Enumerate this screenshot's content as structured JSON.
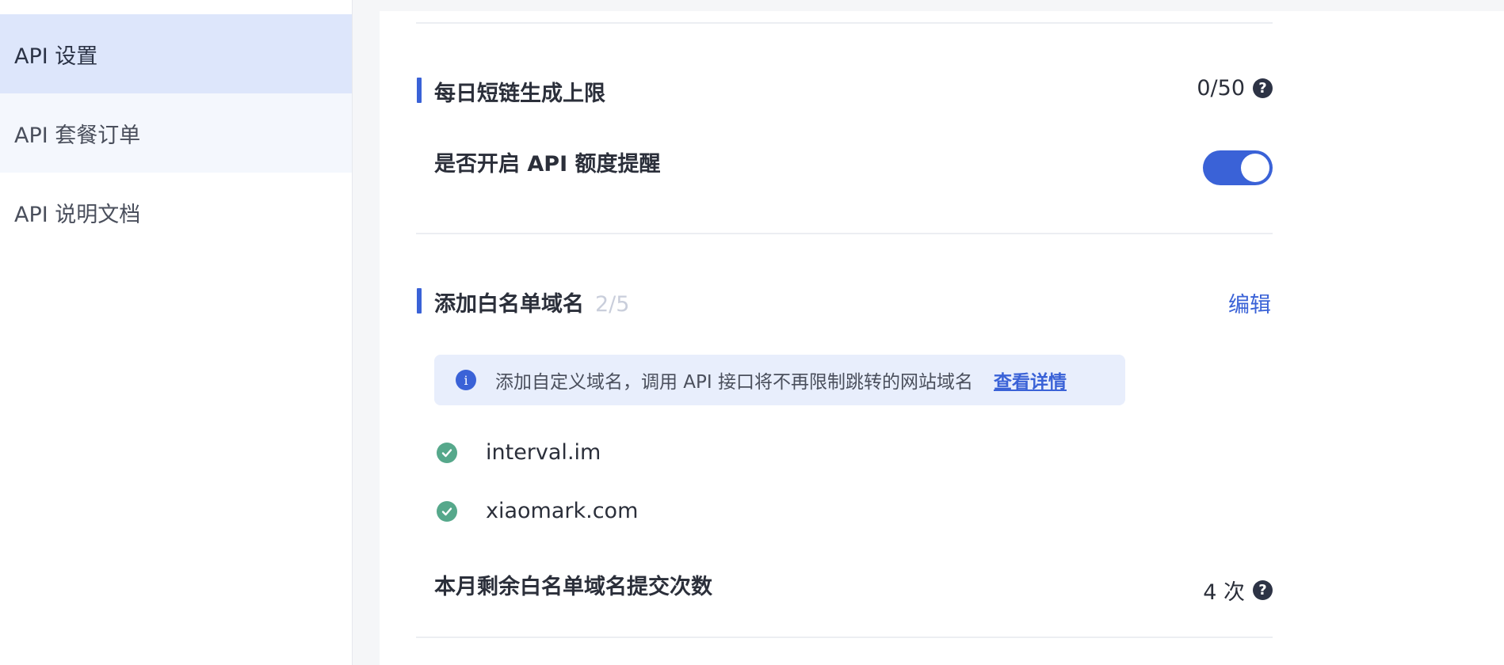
{
  "sidebar": {
    "items": [
      {
        "label": "API 设置",
        "active": true
      },
      {
        "label": "API 套餐订单"
      },
      {
        "label": "API 说明文档"
      }
    ]
  },
  "quota": {
    "title": "每日短链生成上限",
    "value": "0/50"
  },
  "reminder": {
    "title": "是否开启 API 额度提醒",
    "enabled": true
  },
  "whitelist": {
    "title": "添加白名单域名",
    "count": "2/5",
    "edit_label": "编辑",
    "info_text": "添加自定义域名，调用 API 接口将不再限制跳转的网站域名",
    "info_link": "查看详情",
    "domains": [
      "interval.im",
      "xiaomark.com"
    ]
  },
  "monthly": {
    "title": "本月剩余白名单域名提交次数",
    "value": "4 次"
  },
  "colors": {
    "accent": "#3a62d7",
    "success": "#56a88b",
    "active_nav": "#dde6fb"
  },
  "icons": {
    "help": "question-circle-icon",
    "info": "info-circle-icon",
    "check": "check-circle-icon"
  }
}
